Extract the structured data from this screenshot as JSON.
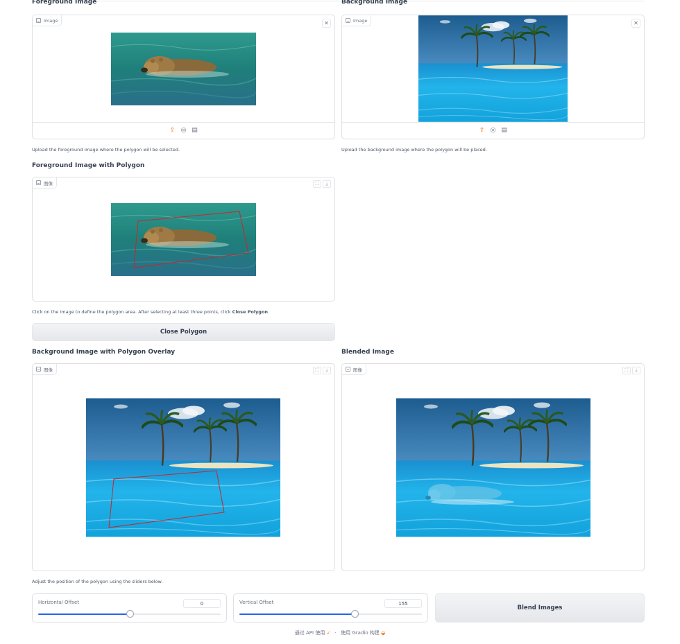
{
  "foreground": {
    "title": "Foreground Image",
    "tag": "Image",
    "hint": "Upload the foreground image where the polygon will be selected."
  },
  "background": {
    "title": "Background Image",
    "tag": "Image",
    "hint": "Upload the background image where the polygon will be placed."
  },
  "polygon_panel": {
    "title": "Foreground Image with Polygon",
    "tag": "图像",
    "hint_prefix": "Click on the image to define the polygon area. After selecting at least three points, click ",
    "hint_bold": "Close Polygon",
    "hint_suffix": "."
  },
  "close_polygon_button": "Close Polygon",
  "overlay_panel": {
    "title": "Background Image with Polygon Overlay",
    "tag": "图像",
    "hint": "Adjust the position of the polygon using the sliders below."
  },
  "blended_panel": {
    "title": "Blended Image",
    "tag": "图像"
  },
  "horizontal": {
    "label": "Horizontal Offset",
    "value": "0",
    "fraction": 0.5
  },
  "vertical": {
    "label": "Vertical Offset",
    "value": "155",
    "fraction": 0.63
  },
  "blend_button": "Blend Images",
  "footer": {
    "api": "通过 API 使用",
    "separator": "·",
    "built": "使用 Gradio 构建"
  },
  "icons": {
    "upload": "upload-icon",
    "webcam": "webcam-icon",
    "clipboard": "clipboard-icon",
    "fullscreen": "fullscreen-icon",
    "download": "download-icon",
    "close": "close-icon",
    "image": "image-icon"
  }
}
